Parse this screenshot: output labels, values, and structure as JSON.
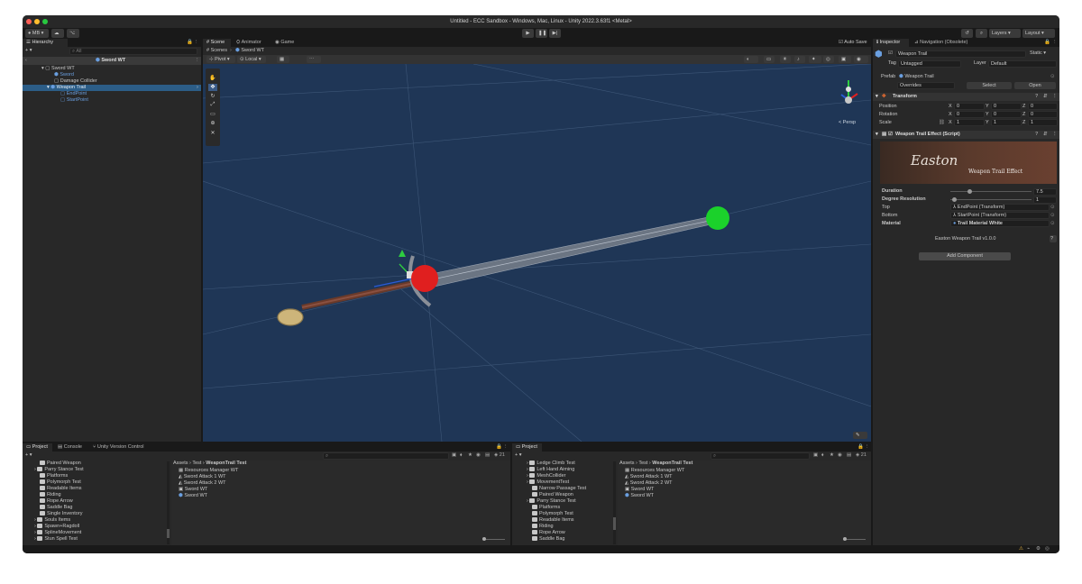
{
  "window": {
    "title": "Untitled - ECC Sandbox - Windows, Mac, Linux - Unity 2022.3.63f1 <Metal>"
  },
  "toolbar": {
    "account": "MB",
    "layers": "Layers",
    "layout": "Layout"
  },
  "hierarchy": {
    "tab": "Hierarchy",
    "search_placeholder": "All",
    "scene_title": "Sword WT",
    "items": [
      {
        "label": "Sword WT",
        "blue": false
      },
      {
        "label": "Sword",
        "blue": true
      },
      {
        "label": "Damage Collider",
        "blue": false
      },
      {
        "label": "Weapon Trail",
        "blue": true
      },
      {
        "label": "EndPoint",
        "blue": true
      },
      {
        "label": "StartPoint",
        "blue": true
      }
    ]
  },
  "scene": {
    "tabs": [
      "Scene",
      "Animator",
      "Game"
    ],
    "auto_save": "Auto Save",
    "breadcrumb_root": "Scenes",
    "breadcrumb_current": "Sword WT",
    "pivot": "Pivot",
    "local": "Local",
    "persp": "< Persp"
  },
  "inspector": {
    "tabs": [
      "Inspector",
      "Navigation (Obsolete)"
    ],
    "object_name": "Weapon Trail",
    "static": "Static",
    "tag_label": "Tag",
    "tag_value": "Untagged",
    "layer_label": "Layer",
    "layer_value": "Default",
    "prefab_label": "Prefab",
    "prefab_value": "Weapon Trail",
    "overrides": "Overrides",
    "select": "Select",
    "open": "Open",
    "transform": {
      "title": "Transform",
      "position_label": "Position",
      "rotation_label": "Rotation",
      "scale_label": "Scale",
      "position": [
        "0",
        "0",
        "0"
      ],
      "rotation": [
        "0",
        "0",
        "0"
      ],
      "scale": [
        "1",
        "1",
        "1"
      ]
    },
    "script": {
      "title": "Weapon Trail Effect (Script)",
      "banner_logo": "Easton",
      "banner_subtitle": "Weapon Trail Effect",
      "duration_label": "Duration",
      "duration_value": "7.5",
      "duration_fraction": 0.22,
      "degree_label": "Degree Resolution",
      "degree_value": "1",
      "degree_fraction": 0.02,
      "top_label": "Top",
      "top_value": "EndPoint (Transform)",
      "bottom_label": "Bottom",
      "bottom_value": "StartPoint (Transform)",
      "material_label": "Material",
      "material_value": "Trail Material White",
      "version": "Easton Weapon Trail v1.0.0"
    },
    "add_component": "Add Component"
  },
  "project_left": {
    "tabs": [
      "Project",
      "Console",
      "Unity Version Control"
    ],
    "count": "21",
    "folders": [
      "Paired Weapon",
      "Parry Stance Test",
      "Platforms",
      "Polymorph Test",
      "Readable Items",
      "Riding",
      "Rope Arrow",
      "Saddle Bag",
      "Single Inventory",
      "Souls Items",
      "Spawn+Ragdoll",
      "SplineMovement",
      "Stun Spell Test"
    ],
    "breadcrumb": [
      "Assets",
      "Test",
      "WeaponTrail Test"
    ],
    "assets": [
      "Resources Manager WT",
      "Sword Attack 1 WT",
      "Sword Attack 2 WT",
      "Sword WT",
      "Sword WT"
    ]
  },
  "project_right": {
    "tabs": [
      "Project"
    ],
    "count": "21",
    "folders": [
      "Ledge Climb Test",
      "Left Hand Aiming",
      "MeshCollider",
      "MovementTest",
      "Narrow Passage Test",
      "Paired Weapon",
      "Parry Stance Test",
      "Platforms",
      "Polymorph Test",
      "Readable Items",
      "Riding",
      "Rope Arrow",
      "Saddle Bag"
    ],
    "breadcrumb": [
      "Assets",
      "Test",
      "WeaponTrail Test"
    ],
    "assets": [
      "Resources Manager WT",
      "Sword Attack 1 WT",
      "Sword Attack 2 WT",
      "Sword WT",
      "Sword WT"
    ]
  }
}
